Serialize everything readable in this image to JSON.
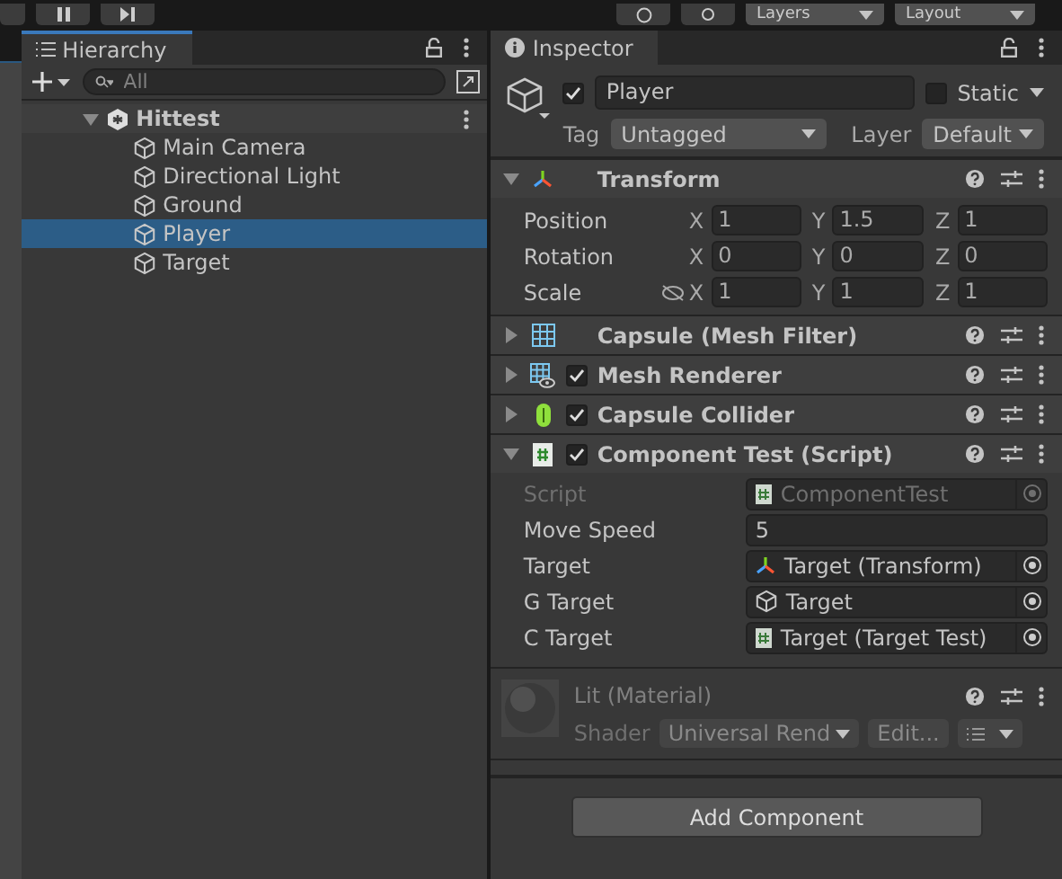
{
  "toolbar": {
    "layers": "Layers",
    "layout": "Layout"
  },
  "hierarchy": {
    "title": "Hierarchy",
    "search": {
      "placeholder": "All"
    },
    "scene": {
      "name": "Hittest",
      "expanded": true,
      "children": [
        {
          "name": "Main Camera",
          "selected": false
        },
        {
          "name": "Directional Light",
          "selected": false
        },
        {
          "name": "Ground",
          "selected": false
        },
        {
          "name": "Player",
          "selected": true
        },
        {
          "name": "Target",
          "selected": false
        }
      ]
    }
  },
  "inspector": {
    "title": "Inspector",
    "object": {
      "active": true,
      "name": "Player",
      "static": false,
      "static_label": "Static",
      "tag_label": "Tag",
      "tag": "Untagged",
      "layer_label": "Layer",
      "layer": "Default"
    },
    "components": [
      {
        "kind": "transform",
        "title": "Transform",
        "expanded": true,
        "rows": [
          {
            "label": "Position",
            "link": false,
            "values": [
              {
                "axis": "X",
                "value": "1"
              },
              {
                "axis": "Y",
                "value": "1.5"
              },
              {
                "axis": "Z",
                "value": "1"
              }
            ]
          },
          {
            "label": "Rotation",
            "link": false,
            "values": [
              {
                "axis": "X",
                "value": "0"
              },
              {
                "axis": "Y",
                "value": "0"
              },
              {
                "axis": "Z",
                "value": "0"
              }
            ]
          },
          {
            "label": "Scale",
            "link": true,
            "values": [
              {
                "axis": "X",
                "value": "1"
              },
              {
                "axis": "Y",
                "value": "1"
              },
              {
                "axis": "Z",
                "value": "1"
              }
            ]
          }
        ]
      },
      {
        "kind": "mesh_filter",
        "title": "Capsule (Mesh Filter)",
        "expanded": false
      },
      {
        "kind": "mesh_renderer",
        "title": "Mesh Renderer",
        "enabled": true,
        "expanded": false
      },
      {
        "kind": "collider",
        "title": "Capsule Collider",
        "enabled": true,
        "expanded": false
      },
      {
        "kind": "script",
        "title": "Component Test (Script)",
        "enabled": true,
        "expanded": true,
        "fields": [
          {
            "label": "Script",
            "kind": "script",
            "value": "ComponentTest",
            "disabled": true
          },
          {
            "label": "Move Speed",
            "kind": "number",
            "value": "5",
            "disabled": false
          },
          {
            "label": "Target",
            "kind": "transform",
            "value": "Target (Transform)",
            "disabled": false
          },
          {
            "label": "G Target",
            "kind": "gameobject",
            "value": "Target",
            "disabled": false
          },
          {
            "label": "C Target",
            "kind": "script",
            "value": "Target (Target Test)",
            "disabled": false
          }
        ]
      }
    ],
    "material": {
      "title": "Lit (Material)",
      "shader_label": "Shader",
      "shader": "Universal Rend",
      "edit": "Edit..."
    },
    "add_component": "Add Component"
  }
}
